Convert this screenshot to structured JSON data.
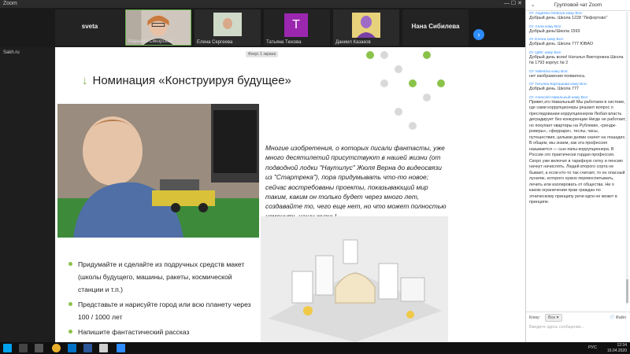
{
  "window": {
    "title": "Zoom",
    "controls": "—  ☐  ✕"
  },
  "left_app": {
    "tab": "Sakh.ru"
  },
  "participants": [
    {
      "name": "sveta",
      "kind": "text"
    },
    {
      "name": "Марьяна Сикорская",
      "kind": "video"
    },
    {
      "name": "Елена Сергеева",
      "kind": "video"
    },
    {
      "name": "Татьяна Тюхова",
      "kind": "avatar",
      "initial": "T"
    },
    {
      "name": "Даниил Казаков",
      "kind": "video"
    },
    {
      "name": "Нана Сибилева",
      "kind": "text"
    }
  ],
  "nav_next_glyph": "›",
  "slide": {
    "sharing_tag": "Фокус 1 экрана",
    "title_arrow": "↓",
    "title": "Номинация «Конструируя будущее»",
    "quote": "Многие изобретения, о которых писали фантасты, уже много десятилетий присутствуют в нашей жизни (от подводной лодки \"Наутилус\" Жюля Верна до видеосвязи из \"Стартрека\"), пора придумывать что-то новое; сейчас востребованы проекты, показывающий мир таким, каким он только будет через много лет, создавайте то, чего еще нет, но что может полностью изменить нашу жизнь!",
    "bullets": [
      "Придумайте и сделайте из подручных средств макет (школы будущего, машины, ракеты, космической станции и т.п.)",
      "Представьте и нарисуйте город или всю планету через 100 / 1000 лет",
      "Напишите фантастический рассказ"
    ]
  },
  "chat": {
    "title": "Групповой чат Zoom",
    "chevron": "⌄",
    "messages": [
      {
        "from": "От Angelina Globova кому Все:",
        "text": "Добрый день. Школа 1228 \"Лефортово\""
      },
      {
        "from": "От Алла кому Все:",
        "text": "Добрый день!Школа 1593"
      },
      {
        "from": "От Елена кому Все:",
        "text": "Добрый день. Школа 777 ЮВАО"
      },
      {
        "from": "От ЦМС кому Все:",
        "text": "Добрый день всем! Наталья Викторовна Школа № 1793 корпус № 2"
      },
      {
        "from": "От Valentina кому Все:",
        "text": "нет изображения появилось"
      },
      {
        "from": "От Татьяна Карташова кому Все:",
        "text": "Добрый день. Школа 777"
      },
      {
        "from": "От Алексей Навальный кому Все:",
        "text": "Привет,это Навальный! Мы работаем в системе, где сами коррупционеры решают вопрос о преследовании коррупционеров Любая власть деградирует без конкуренции Нигде не работает, но покупает квартиры на Рублевке, «рендж-роверы», «феррари», теслы, часы, путешествия, целыми днями скачет на лошадях. В общем, мы знаем, как эта профессия называется — сын папы-коррупционера. В России это практически гордая профессия. Скоро уже включат в тарифную сетку и пенсию начнут начислять. Людей второго сорта не бывает, а если кто-то так считает, то он опасный лунатик, которого нужно перевоспитывать, лечить или изолировать от общества. Ни о каком ограничении прав граждан по этническому принципу речи идти не может в принципе."
      }
    ],
    "to_label": "Кому:",
    "to_value": "Все",
    "file_label": "Файл",
    "input_placeholder": "Введите здесь сообщение..."
  },
  "taskbar": {
    "lang": "РУС",
    "time": "12:34",
    "date": "16.04.2020"
  }
}
